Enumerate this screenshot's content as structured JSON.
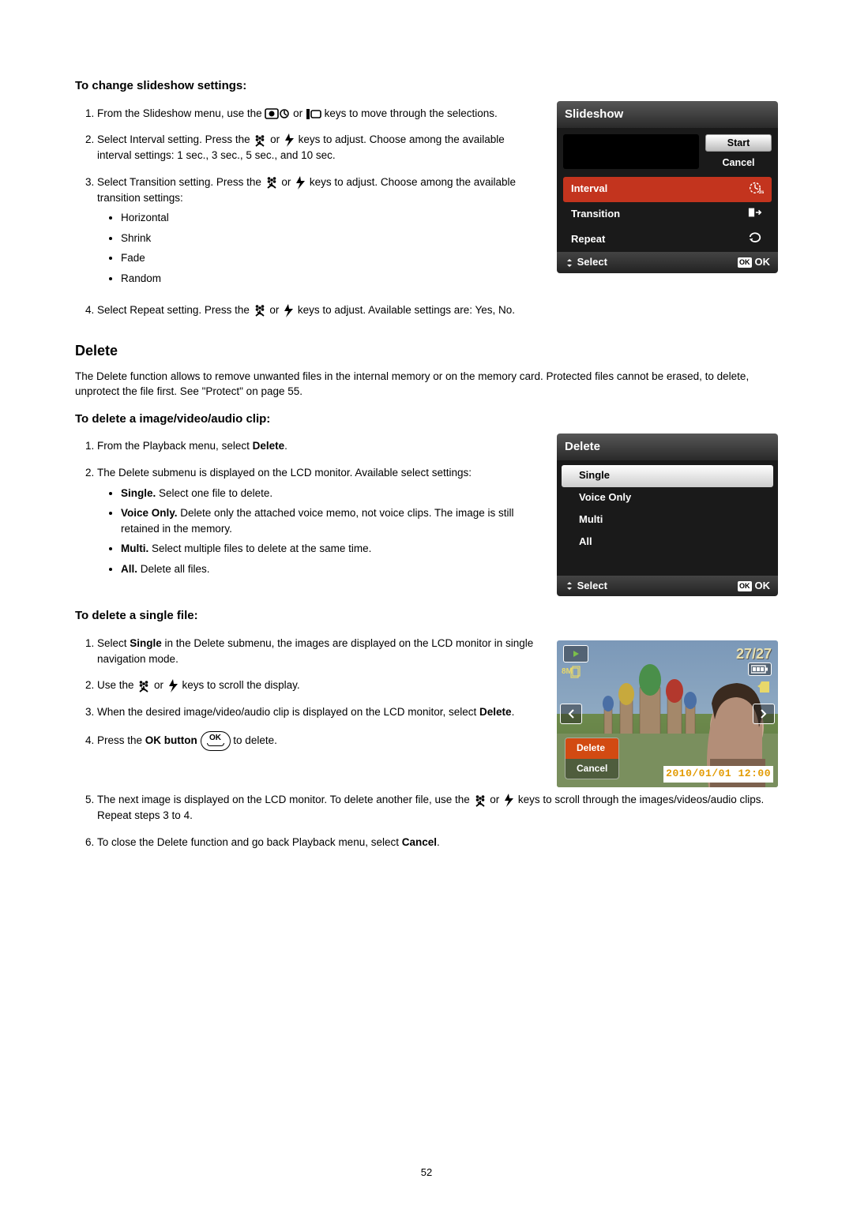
{
  "s1": {
    "heading": "To change slideshow settings:",
    "li1a": "From the Slideshow menu, use the ",
    "li1b": " or ",
    "li1c": " keys to move through the selections.",
    "li2a": "Select Interval setting. Press the ",
    "li2b": " or ",
    "li2c": " keys to adjust. Choose among the available interval settings: 1 sec., 3 sec., 5 sec., and 10 sec.",
    "li3a": "Select Transition setting. Press the ",
    "li3b": " or ",
    "li3c": " keys to adjust. Choose among the available transition settings:",
    "transitions": [
      "Horizontal",
      "Shrink",
      "Fade",
      "Random"
    ],
    "li4a": "Select Repeat setting. Press the ",
    "li4b": " or ",
    "li4c": " keys to adjust. Available settings are: Yes, No."
  },
  "lcd1": {
    "title": "Slideshow",
    "start": "Start",
    "cancel": "Cancel",
    "interval": "Interval",
    "interval_val": "3s",
    "transition": "Transition",
    "repeat": "Repeat",
    "footer_select": "Select",
    "footer_ok": "OK",
    "ok_badge": "OK"
  },
  "del": {
    "heading": "Delete",
    "intro": "The Delete function allows to remove unwanted files in the internal memory or on the memory card. Protected files cannot be erased, to delete, unprotect the file first. See \"Protect\" on page 55."
  },
  "s2": {
    "heading": "To delete a image/video/audio clip:",
    "li1a": "From the Playback menu, select ",
    "li1b": "Delete",
    "li1c": ".",
    "li2": "The Delete submenu is displayed on the LCD monitor. Available select settings:",
    "sub_single_b": "Single.",
    "sub_single_t": " Select one file to delete.",
    "sub_voice_b": "Voice Only.",
    "sub_voice_t": " Delete only the attached voice memo, not voice clips. The image is still retained in the memory.",
    "sub_multi_b": "Multi.",
    "sub_multi_t": " Select multiple files to delete at the same time.",
    "sub_all_b": "All.",
    "sub_all_t": " Delete all files."
  },
  "lcd2": {
    "title": "Delete",
    "items": [
      "Single",
      "Voice Only",
      "Multi",
      "All"
    ],
    "footer_select": "Select",
    "footer_ok": "OK",
    "ok_badge": "OK"
  },
  "s3": {
    "heading": "To delete a single file:",
    "li1a": "Select ",
    "li1b": "Single",
    "li1c": " in the Delete submenu, the images are displayed on the LCD monitor in single navigation mode.",
    "li2a": "Use the ",
    "li2b": " or ",
    "li2c": " keys to scroll the display.",
    "li3a": "When the desired image/video/audio clip is displayed on the LCD monitor, select ",
    "li3b": "Delete",
    "li3c": ".",
    "li4a": "Press the ",
    "li4b": "OK button",
    "li4c": " to delete.",
    "li5a": "The next image is displayed on the LCD monitor. To delete another file, use the ",
    "li5b": " or ",
    "li5c": " keys to scroll through the images/videos/audio clips. Repeat steps 3 to 4.",
    "li6a": "To close the Delete function and go back Playback menu, select ",
    "li6b": "Cancel",
    "li6c": "."
  },
  "lcd3": {
    "counter": "27/27",
    "res": "8M",
    "delete": "Delete",
    "cancel": "Cancel",
    "timestamp": "2010/01/01 12:00"
  },
  "ok_btn": "OK",
  "page": "52"
}
